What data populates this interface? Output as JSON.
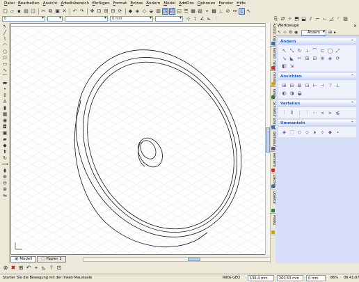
{
  "menu": [
    {
      "label": "Datei",
      "ul": "D",
      "rest": "atei"
    },
    {
      "label": "Bearbeiten",
      "ul": "B",
      "rest": "earbeiten"
    },
    {
      "label": "Ansicht",
      "ul": "A",
      "rest": "nsicht"
    },
    {
      "label": "Arbeitsbereich",
      "ul": "A",
      "rest": "rbeitsbereich"
    },
    {
      "label": "Einfügen",
      "ul": "E",
      "rest": "infügen"
    },
    {
      "label": "Format",
      "ul": "F",
      "rest": "ormat"
    },
    {
      "label": "Extras",
      "ul": "E",
      "rest": "xtras"
    },
    {
      "label": "Ändern",
      "ul": "Ä",
      "rest": "ndern"
    },
    {
      "label": "Modul",
      "ul": "M",
      "rest": "odul"
    },
    {
      "label": "AddOns",
      "ul": "A",
      "rest": "ddOns"
    },
    {
      "label": "Optionen",
      "ul": "O",
      "rest": "ptionen"
    },
    {
      "label": "Fenster",
      "ul": "F",
      "rest": "enster"
    },
    {
      "label": "Hilfe",
      "ul": "H",
      "rest": "ilfe"
    }
  ],
  "toolbar2": {
    "layer_value": "0",
    "linetype_value": "",
    "lineweight_value": "0 mm",
    "color_value": ""
  },
  "tabs": {
    "model": "Modell",
    "layout": "Papier 1"
  },
  "panel": {
    "title": "Werkzeuge",
    "close_glyph": "×",
    "combo_value": "Ändern",
    "sections": [
      {
        "title": "Ändern",
        "rows": [
          [
            "↖",
            "⤡",
            "↻",
            "⟂",
            "⌒",
            "⊏",
            "◯",
            "⤢"
          ],
          [
            "↘",
            "◣",
            "✂",
            "⊞",
            "⊟",
            "⊕",
            "◈",
            "⟳"
          ],
          [
            "◧",
            "⇲"
          ]
        ]
      },
      {
        "title": "Ansichten",
        "rows": [
          [
            "⊞",
            "⊟",
            "⊠",
            "⊡",
            "⊢",
            "⊣",
            "⊤",
            "⊥"
          ],
          [
            "◐",
            "◑",
            "◒"
          ]
        ]
      },
      {
        "title": "Verteilen",
        "rows": [
          [
            "⫶",
            "⫴",
            "⋮",
            "⫶",
            "⋯",
            "⫷",
            "⫸",
            "⫹"
          ]
        ]
      },
      {
        "title": "Ummanteln",
        "rows": [
          [
            "◈",
            "⬚",
            "◇",
            "⬦",
            "⬧",
            "⬨",
            "⬥",
            "⬩"
          ]
        ]
      }
    ]
  },
  "vtabs": [
    {
      "label": "Konstr. Fassade Ändern",
      "color": "#3a6ea5"
    },
    {
      "label": "Konstr. Fassade Erzeugen",
      "color": "#c0392b"
    },
    {
      "label": "Fenster",
      "color": "#d4a017"
    },
    {
      "label": "Türen",
      "color": "#2e7d32"
    },
    {
      "label": "Schraffur und Gruppen",
      "color": "#3a6ea5"
    },
    {
      "label": "Bemaßung",
      "color": "#6b4a9b"
    },
    {
      "label": "Rendern",
      "color": "#c0392b"
    },
    {
      "label": "Dächer",
      "color": "#3a6ea5"
    },
    {
      "label": "Objekte",
      "color": "#2e7d32"
    },
    {
      "label": "Modul",
      "color": "#d4a017"
    }
  ],
  "status": {
    "message": "Starten Sie die Bewegung mit der linken Maustaste",
    "mode_labels": "RING GEO",
    "x_value": "136,4 mm",
    "y_value": "200,53 mm",
    "z_value": "0 mm",
    "zoom": "86%",
    "time": "06:41:07"
  }
}
